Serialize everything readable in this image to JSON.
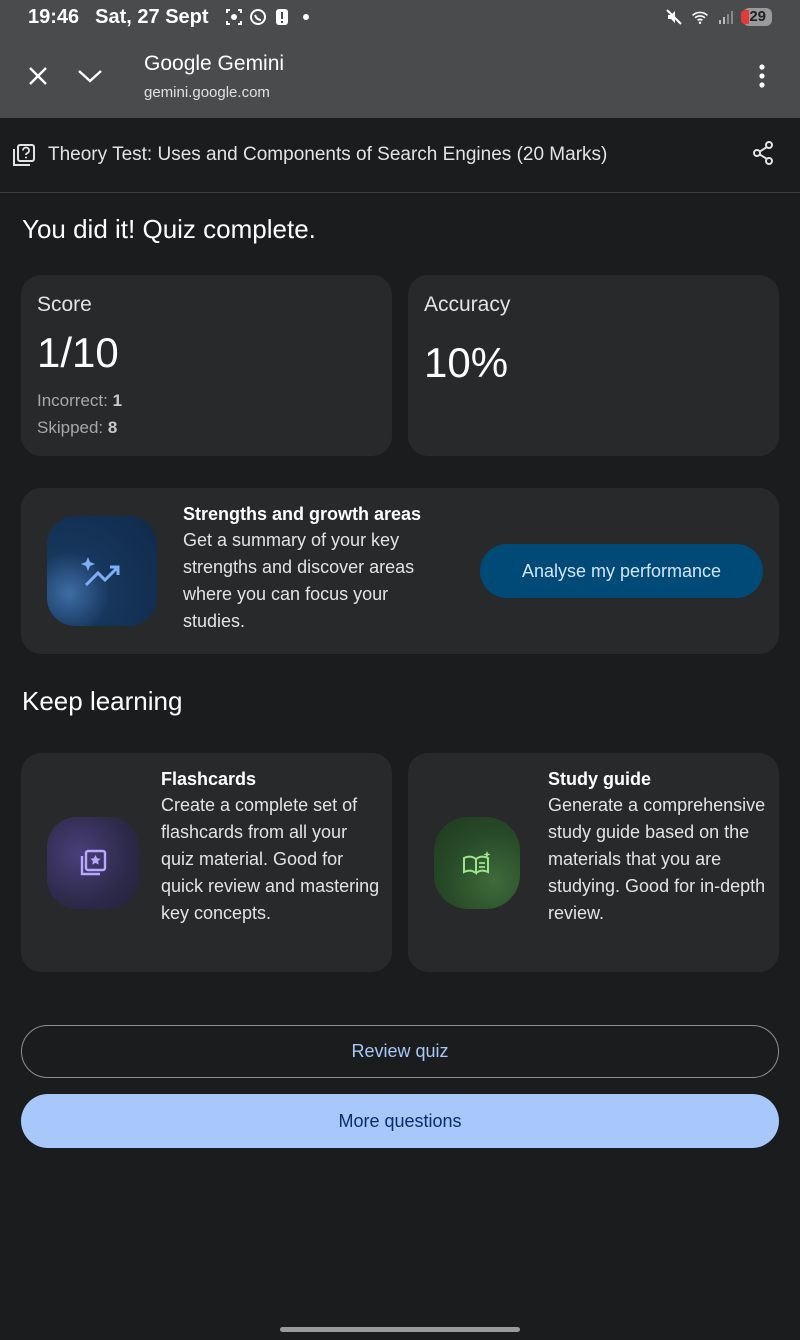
{
  "status_bar": {
    "time": "19:46",
    "date": "Sat, 27 Sept",
    "battery": "29",
    "icons": [
      "screenshot-icon",
      "whatsapp-icon",
      "alert-icon",
      "dot-icon",
      "mute-icon",
      "wifi-icon",
      "signal-icon"
    ]
  },
  "browser": {
    "title": "Google Gemini",
    "url": "gemini.google.com"
  },
  "page": {
    "title": "Theory Test: Uses and Components of Search Engines (20 Marks)"
  },
  "result": {
    "heading": "You did it! Quiz complete.",
    "score_label": "Score",
    "score_value": "1/10",
    "incorrect_label": "Incorrect:",
    "incorrect_value": "1",
    "skipped_label": "Skipped:",
    "skipped_value": "8",
    "accuracy_label": "Accuracy",
    "accuracy_value": "10%"
  },
  "performance": {
    "title": "Strengths and growth areas",
    "body": "Get a summary of your key strengths and discover areas where you can focus your studies.",
    "button": "Analyse my performance"
  },
  "keep_learning": {
    "heading": "Keep learning",
    "flashcards": {
      "title": "Flashcards",
      "body": "Create a complete set of flashcards from all your quiz material. Good for quick review and mastering key concepts."
    },
    "study_guide": {
      "title": "Study guide",
      "body": "Generate a comprehensive study guide based on the materials that you are studying. Good for in-depth review."
    }
  },
  "actions": {
    "review": "Review quiz",
    "more": "More questions"
  },
  "colors": {
    "background": "#1b1c1d",
    "card": "#28292b",
    "primary_button": "#a8c7fa",
    "analyse_button": "#004a77"
  }
}
